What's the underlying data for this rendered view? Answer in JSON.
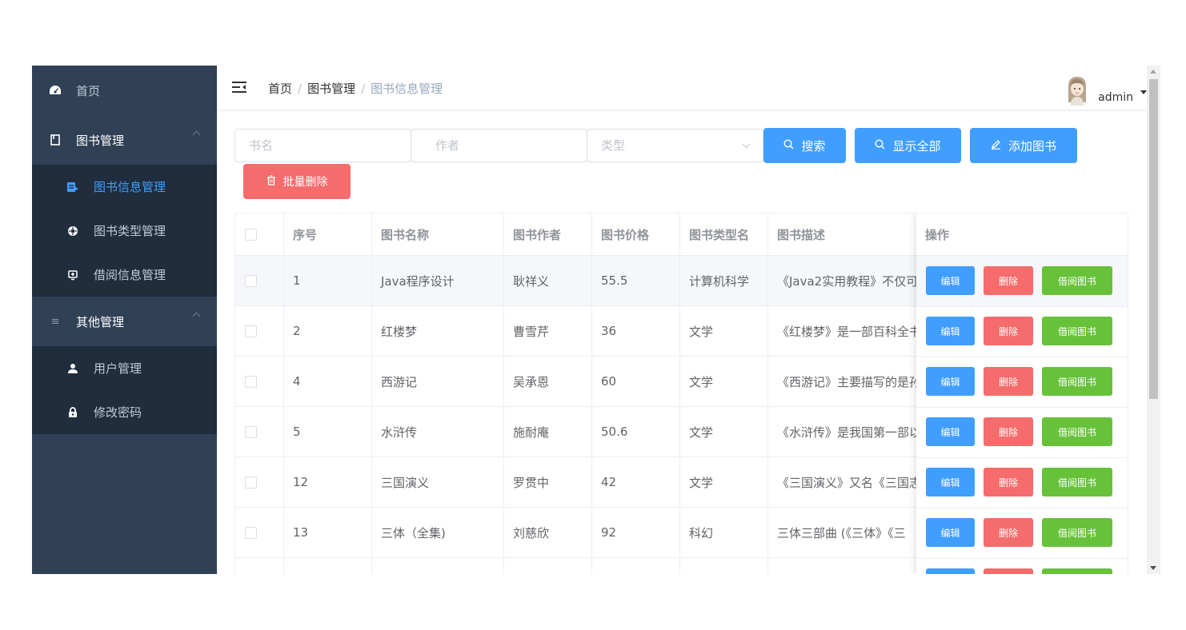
{
  "sidebar": {
    "items": [
      {
        "label": "首页",
        "icon": "dashboard-icon"
      },
      {
        "label": "图书管理",
        "icon": "book-icon"
      },
      {
        "label": "图书信息管理",
        "icon": "book-info-icon",
        "active": true
      },
      {
        "label": "图书类型管理",
        "icon": "category-icon"
      },
      {
        "label": "借阅信息管理",
        "icon": "borrow-icon"
      },
      {
        "label": "其他管理",
        "icon": "list-icon"
      },
      {
        "label": "用户管理",
        "icon": "user-icon"
      },
      {
        "label": "修改密码",
        "icon": "lock-icon"
      }
    ]
  },
  "header": {
    "breadcrumb": [
      "首页",
      "图书管理",
      "图书信息管理"
    ],
    "separator": "/",
    "username": "admin"
  },
  "filter": {
    "name_placeholder": "书名",
    "author_placeholder": "作者",
    "type_placeholder": "类型",
    "search_label": "搜索",
    "show_all_label": "显示全部",
    "add_label": "添加图书",
    "batch_delete_label": "批量删除"
  },
  "table": {
    "columns": [
      "序号",
      "图书名称",
      "图书作者",
      "图书价格",
      "图书类型名",
      "图书描述",
      "操作"
    ],
    "rows": [
      {
        "id": "1",
        "name": "Java程序设计",
        "author": "耿祥义",
        "price": "55.5",
        "type": "计算机科学",
        "desc": "《Java2实用教程》不仅可"
      },
      {
        "id": "2",
        "name": "红楼梦",
        "author": "曹雪芹",
        "price": "36",
        "type": "文学",
        "desc": "《红楼梦》是一部百科全书"
      },
      {
        "id": "4",
        "name": "西游记",
        "author": "吴承恩",
        "price": "60",
        "type": "文学",
        "desc": "《西游记》主要描写的是孙"
      },
      {
        "id": "5",
        "name": "水浒传",
        "author": "施耐庵",
        "price": "50.6",
        "type": "文学",
        "desc": "《水浒传》是我国第一部以"
      },
      {
        "id": "12",
        "name": "三国演义",
        "author": "罗贯中",
        "price": "42",
        "type": "文学",
        "desc": "《三国演义》又名《三国志"
      },
      {
        "id": "13",
        "name": "三体（全集)",
        "author": "刘慈欣",
        "price": "92",
        "type": "科幻",
        "desc": "三体三部曲 (《三体》《三"
      }
    ],
    "actions": {
      "edit": "编辑",
      "delete": "删除",
      "borrow": "借阅图书"
    }
  },
  "colors": {
    "sidebar_bg": "#304156",
    "submenu_bg": "#1f2d3d",
    "primary": "#409eff",
    "danger": "#f56c6c",
    "success": "#67c23a"
  }
}
